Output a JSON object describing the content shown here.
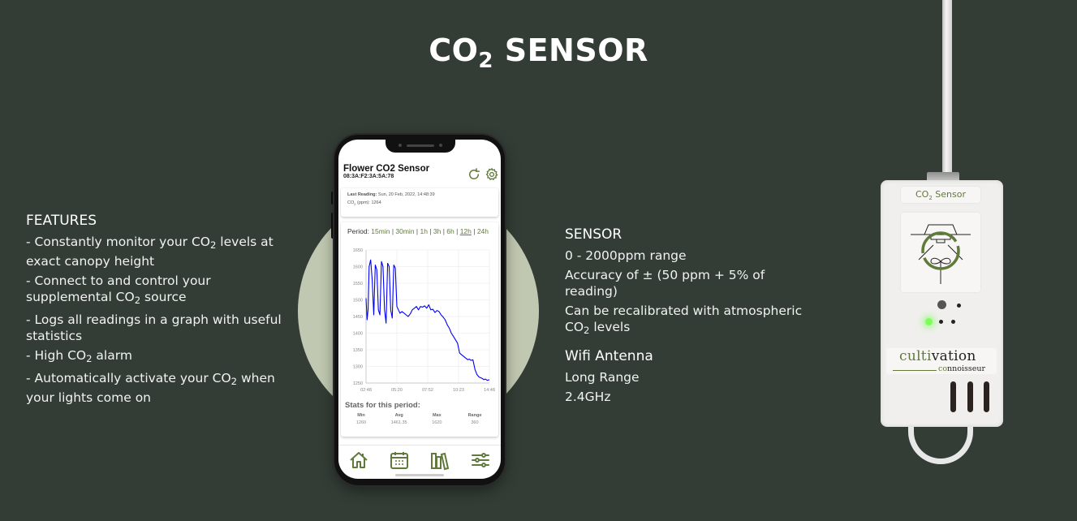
{
  "page": {
    "title_prefix": "CO",
    "title_sub": "2",
    "title_suffix": " SENSOR",
    "colors": {
      "background": "#333d35",
      "accent_green": "#5f7a3a",
      "circle": "#c1c8b1",
      "chart_line": "#0000ff"
    }
  },
  "features": {
    "heading": "FEATURES",
    "items": [
      {
        "a": "-  Constantly monitor your CO",
        "sub": "2",
        "b": " levels at exact canopy height"
      },
      {
        "a": "-  Connect to and control your supplemental CO",
        "sub": "2",
        "b": " source"
      },
      {
        "a": "-  Logs all readings in a graph with useful statistics",
        "sub": "",
        "b": ""
      },
      {
        "a": "-  High CO",
        "sub": "2",
        "b": " alarm"
      },
      {
        "a": "-  Automatically activate your CO",
        "sub": "2",
        "b": " when your lights come on"
      }
    ]
  },
  "specs": {
    "sensor_heading": "SENSOR",
    "sensor_lines": [
      {
        "a": "0 - 2000ppm range",
        "sub": "",
        "b": ""
      },
      {
        "a": "Accuracy of ± (50 ppm + 5% of reading)",
        "sub": "",
        "b": ""
      },
      {
        "a": "Can be recalibrated with atmospheric CO",
        "sub": "2",
        "b": " levels"
      }
    ],
    "wifi_heading": "Wifi Antenna",
    "wifi_lines": [
      "Long Range",
      "2.4GHz"
    ]
  },
  "app": {
    "title": "Flower CO2 Sensor",
    "mac": "08:3A:F2:3A:5A:78",
    "icons": {
      "refresh": "refresh-icon",
      "settings": "gear-icon"
    },
    "last_reading_label": "Last Reading:",
    "last_reading_value": " Sun, 20 Feb, 2022, 14:48:39",
    "co2_label": "CO",
    "co2_sub": "2",
    "co2_unit": " (ppm): ",
    "co2_value": "1264",
    "period_label": "Period: ",
    "period_options": [
      "15min",
      "30min",
      "1h",
      "3h",
      "6h",
      "12h",
      "24h"
    ],
    "period_active": "12h",
    "stats_title": "Stats for this period:",
    "stats": [
      {
        "key": "Min",
        "value": "1260"
      },
      {
        "key": "Avg",
        "value": "1461.35"
      },
      {
        "key": "Max",
        "value": "1620"
      },
      {
        "key": "Range",
        "value": "360"
      }
    ],
    "nav": [
      "home-icon",
      "calendar-icon",
      "library-icon",
      "sliders-icon"
    ]
  },
  "chart_data": {
    "type": "line",
    "title": "",
    "xlabel": "",
    "ylabel": "",
    "x_ticks": [
      "02:48",
      "05:20",
      "07:52",
      "10:23",
      "14:48"
    ],
    "y_ticks": [
      1250,
      1300,
      1350,
      1400,
      1450,
      1500,
      1550,
      1600,
      1650
    ],
    "ylim": [
      1250,
      1650
    ],
    "xlim_hours": [
      0,
      12
    ],
    "grid": true,
    "series": [
      {
        "name": "CO2 (ppm)",
        "x": [
          0,
          0.1,
          0.2,
          0.3,
          0.45,
          0.6,
          0.75,
          0.9,
          1.05,
          1.2,
          1.35,
          1.5,
          1.65,
          1.8,
          1.95,
          2.1,
          2.25,
          2.4,
          2.55,
          2.7,
          2.85,
          3.0,
          3.15,
          3.3,
          3.5,
          3.7,
          3.9,
          4.1,
          4.3,
          4.5,
          4.7,
          4.9,
          5.1,
          5.3,
          5.5,
          5.7,
          5.9,
          6.1,
          6.3,
          6.5,
          6.7,
          6.9,
          7.1,
          7.3,
          7.5,
          7.7,
          7.9,
          8.1,
          8.3,
          8.5,
          8.7,
          8.9,
          9.1,
          9.3,
          9.5,
          9.7,
          9.9,
          10.05,
          10.2,
          10.4,
          10.6,
          10.8,
          11.0,
          11.2,
          11.4,
          11.45,
          11.6,
          11.8,
          12.0
        ],
        "values": [
          1505,
          1440,
          1470,
          1600,
          1620,
          1560,
          1455,
          1605,
          1590,
          1470,
          1455,
          1615,
          1600,
          1470,
          1430,
          1610,
          1600,
          1470,
          1445,
          1605,
          1595,
          1480,
          1470,
          1460,
          1465,
          1460,
          1455,
          1450,
          1458,
          1470,
          1475,
          1480,
          1470,
          1480,
          1478,
          1482,
          1475,
          1485,
          1470,
          1472,
          1462,
          1468,
          1465,
          1455,
          1448,
          1440,
          1425,
          1415,
          1400,
          1390,
          1380,
          1370,
          1340,
          1335,
          1330,
          1325,
          1320,
          1322,
          1318,
          1320,
          1290,
          1275,
          1268,
          1265,
          1262,
          1260,
          1262,
          1258,
          1260
        ]
      }
    ]
  },
  "device": {
    "label_prefix": "CO",
    "label_sub": "2",
    "label_suffix": " Sensor",
    "brand_line1_a": "culti",
    "brand_line1_b": "vation",
    "brand_line2_a": "co",
    "brand_line2_b": "nnoisseur"
  }
}
